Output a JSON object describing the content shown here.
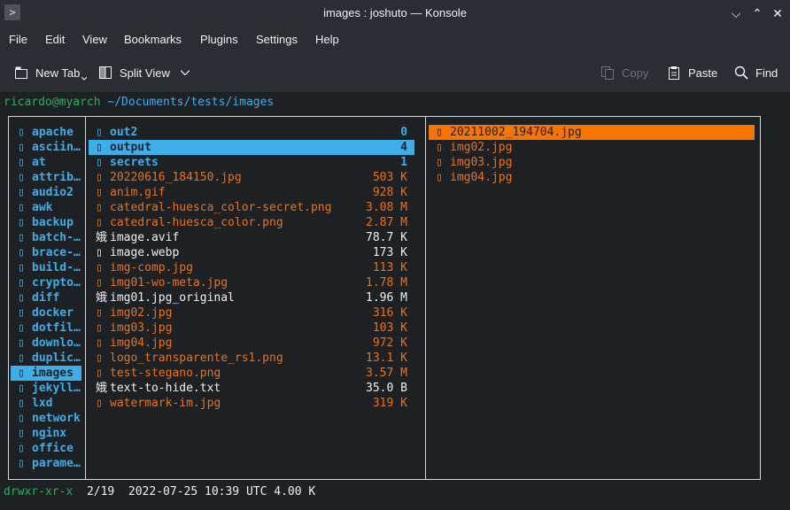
{
  "window": {
    "title": "images : joshuto — Konsole",
    "app_icon": ">"
  },
  "menu": [
    "File",
    "Edit",
    "View",
    "Bookmarks",
    "Plugins",
    "Settings",
    "Help"
  ],
  "toolbar": {
    "new_tab": "New Tab",
    "split_view": "Split View",
    "copy": "Copy",
    "paste": "Paste",
    "find": "Find"
  },
  "prompt": {
    "user": "ricardo@myarch",
    "path": "~/Documents/tests/images"
  },
  "parent_col": [
    {
      "name": "apache",
      "icon": "folder-icon"
    },
    {
      "name": "asciin…",
      "icon": "folder-icon"
    },
    {
      "name": "at",
      "icon": "folder-icon"
    },
    {
      "name": "attrib…",
      "icon": "folder-icon"
    },
    {
      "name": "audio2",
      "icon": "folder-icon"
    },
    {
      "name": "awk",
      "icon": "folder-icon"
    },
    {
      "name": "backup",
      "icon": "folder-icon"
    },
    {
      "name": "batch-…",
      "icon": "folder-icon"
    },
    {
      "name": "brace-…",
      "icon": "folder-icon"
    },
    {
      "name": "build-…",
      "icon": "folder-icon"
    },
    {
      "name": "crypto…",
      "icon": "folder-icon"
    },
    {
      "name": "diff",
      "icon": "folder-icon"
    },
    {
      "name": "docker",
      "icon": "folder-icon"
    },
    {
      "name": "dotfil…",
      "icon": "folder-icon"
    },
    {
      "name": "downlo…",
      "icon": "folder-icon"
    },
    {
      "name": "duplic…",
      "icon": "folder-icon"
    },
    {
      "name": "images",
      "icon": "folder-icon",
      "selected": true
    },
    {
      "name": "jekyll…",
      "icon": "folder-icon"
    },
    {
      "name": "lxd",
      "icon": "folder-icon"
    },
    {
      "name": "network",
      "icon": "folder-icon"
    },
    {
      "name": "nginx",
      "icon": "folder-icon"
    },
    {
      "name": "office",
      "icon": "folder-icon"
    },
    {
      "name": "parame…",
      "icon": "folder-icon"
    }
  ],
  "current_col": [
    {
      "name": "out2",
      "size": "0",
      "kind": "dir"
    },
    {
      "name": "output",
      "size": "4",
      "kind": "dir",
      "selected": true
    },
    {
      "name": "secrets",
      "size": "1",
      "kind": "dir"
    },
    {
      "name": "20220616_184150.jpg",
      "size": "503 K",
      "kind": "img"
    },
    {
      "name": "anim.gif",
      "size": "928 K",
      "kind": "img"
    },
    {
      "name": "catedral-huesca_color-secret.png",
      "size": "3.08 M",
      "kind": "img"
    },
    {
      "name": "catedral-huesca_color.png",
      "size": "2.87 M",
      "kind": "img"
    },
    {
      "name": "image.avif",
      "size": "78.7 K",
      "kind": "plain",
      "glyph": "娥"
    },
    {
      "name": "image.webp",
      "size": "173 K",
      "kind": "plain"
    },
    {
      "name": "img-comp.jpg",
      "size": "113 K",
      "kind": "img"
    },
    {
      "name": "img01-wo-meta.jpg",
      "size": "1.78 M",
      "kind": "img"
    },
    {
      "name": "img01.jpg_original",
      "size": "1.96 M",
      "kind": "plain",
      "glyph": "娥"
    },
    {
      "name": "img02.jpg",
      "size": "316 K",
      "kind": "img"
    },
    {
      "name": "img03.jpg",
      "size": "103 K",
      "kind": "img"
    },
    {
      "name": "img04.jpg",
      "size": "972 K",
      "kind": "img"
    },
    {
      "name": "logo_transparente_rs1.png",
      "size": "13.1 K",
      "kind": "img"
    },
    {
      "name": "test-stegano.png",
      "size": "3.57 M",
      "kind": "img"
    },
    {
      "name": "text-to-hide.txt",
      "size": "35.0 B",
      "kind": "plain",
      "glyph": "娥"
    },
    {
      "name": "watermark-im.jpg",
      "size": "319 K",
      "kind": "img"
    }
  ],
  "preview_col": [
    {
      "name": "20211002_194704.jpg",
      "selected": true
    },
    {
      "name": "img02.jpg"
    },
    {
      "name": "img03.jpg"
    },
    {
      "name": "img04.jpg"
    }
  ],
  "status": {
    "permissions": "drwxr-xr-x",
    "position": "2/19",
    "datetime": "2022-07-25 10:39 UTC",
    "size": "4.00 K"
  },
  "colors": {
    "dir": "#3daee9",
    "image": "#e8731a",
    "selection_dir": "#3daee9",
    "selection_preview": "#f67400",
    "user": "#27ae60"
  }
}
